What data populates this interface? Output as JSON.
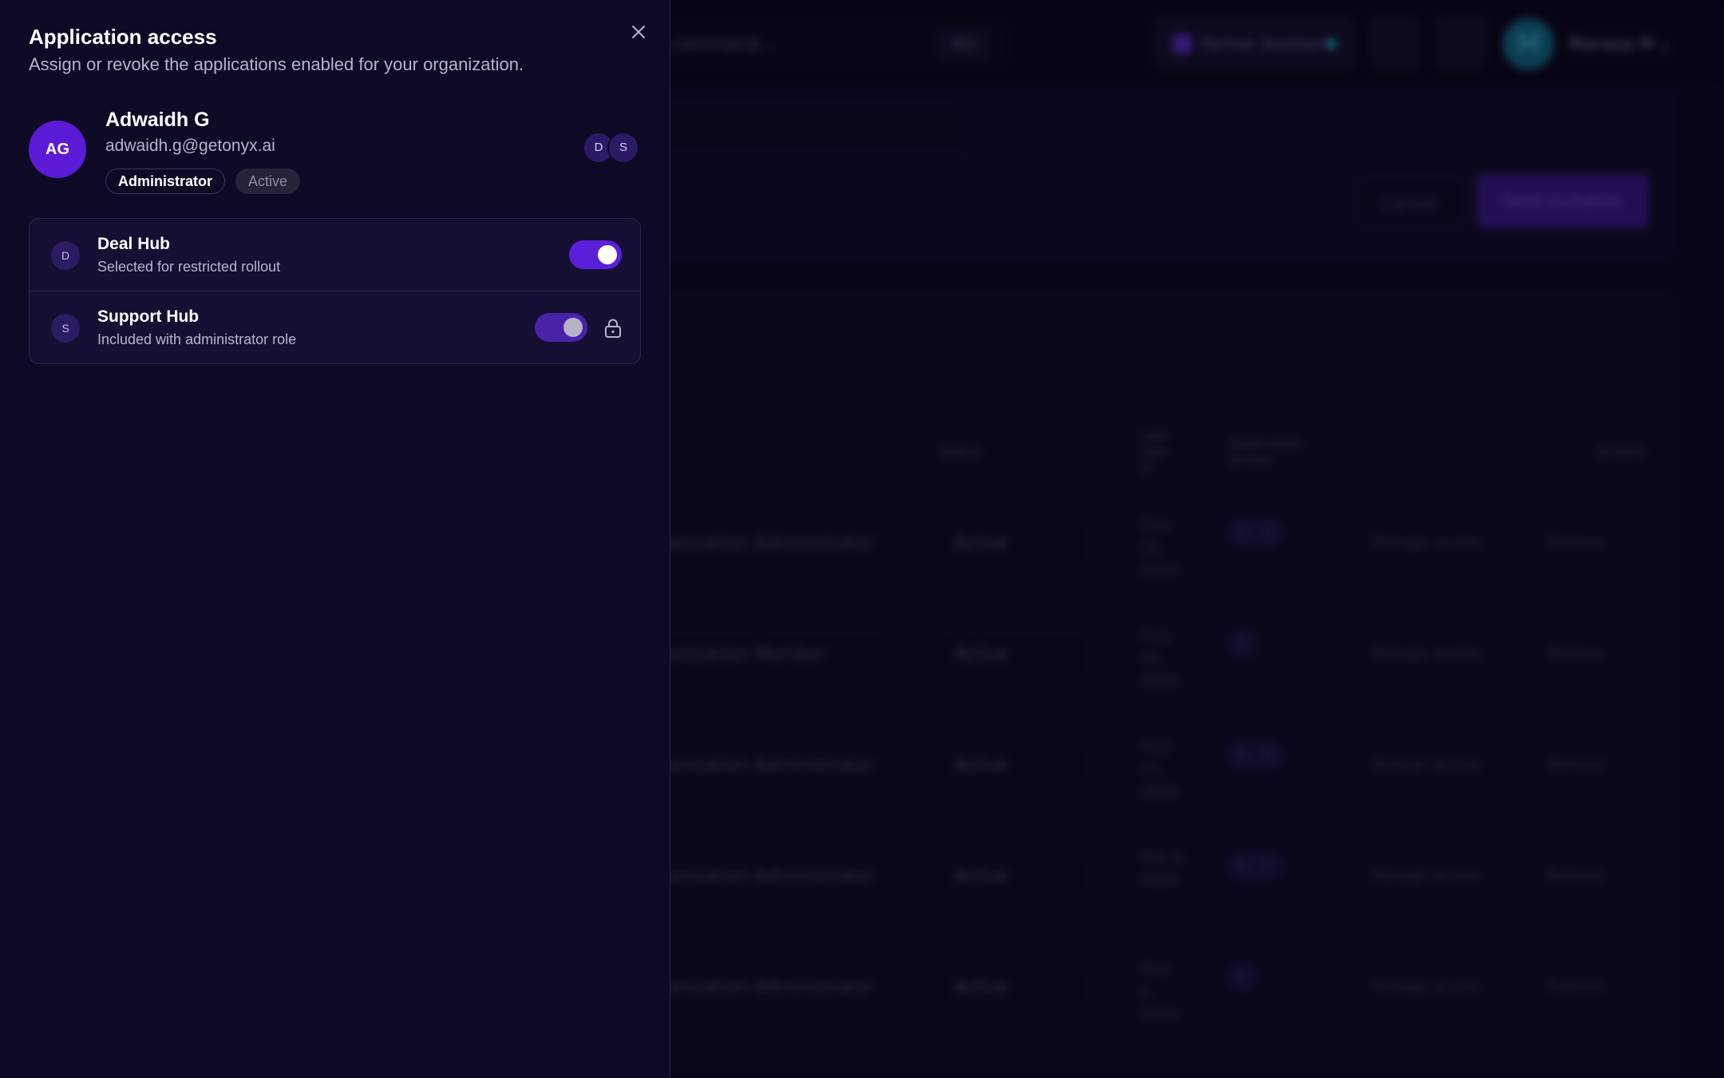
{
  "panel": {
    "title": "Application access",
    "subtitle": "Assign or revoke the applications enabled for your organization.",
    "close_icon": "close-icon"
  },
  "user": {
    "initials": "AG",
    "name": "Adwaidh G",
    "email": "adwaidh.g@getonyx.ai",
    "role_badge": "Administrator",
    "status_badge": "Active",
    "app_initials": [
      "D",
      "S"
    ]
  },
  "apps": [
    {
      "initial": "D",
      "name": "Deal Hub",
      "description": "Selected for restricted rollout",
      "enabled": true,
      "locked": false
    },
    {
      "initial": "S",
      "name": "Support Hub",
      "description": "Included with administrator role",
      "enabled": true,
      "locked": true,
      "lock_icon": "lock-icon"
    }
  ],
  "background": {
    "search_placeholder": "command...",
    "search_shortcut": "⌘K",
    "partner_assistant": "Partner Assistant",
    "account_initial": "M",
    "account_name": "Manasa M",
    "cancel_label": "Cancel",
    "send_label": "Send invitation",
    "table_headers": {
      "status": "Status",
      "last_sign_in": "Last sign-in",
      "application_access": "Application access",
      "actions": "Actions"
    },
    "rows": [
      {
        "role": "anization Administrator",
        "status": "Active",
        "date": "Aug 18, 2026",
        "apps": [
          "D",
          "S"
        ],
        "manage": "Manage access",
        "remove": "Remove"
      },
      {
        "role": "anization Member",
        "status": "Active",
        "date": "Aug 10, 2026",
        "apps": [
          "D"
        ],
        "manage": "Manage access",
        "remove": "Remove"
      },
      {
        "role": "anization Administrator",
        "status": "Active",
        "date": "Aug 17, 2026",
        "apps": [
          "D",
          "S"
        ],
        "manage": "Manage access",
        "remove": "Remove"
      },
      {
        "role": "anization Administrator",
        "status": "Active",
        "date": "Sep 8, 2026",
        "apps": [
          "D",
          "S"
        ],
        "manage": "Manage access",
        "remove": "Remove"
      },
      {
        "role": "anization Administrator",
        "status": "Active",
        "date": "Aug 6, 2026",
        "apps": [
          "S"
        ],
        "manage": "Manage access",
        "remove": "Remove"
      }
    ]
  },
  "colors": {
    "accent": "#5a1fd8",
    "panel_bg": "#0e0a25",
    "avatar_bg": "#5b1ad6"
  }
}
